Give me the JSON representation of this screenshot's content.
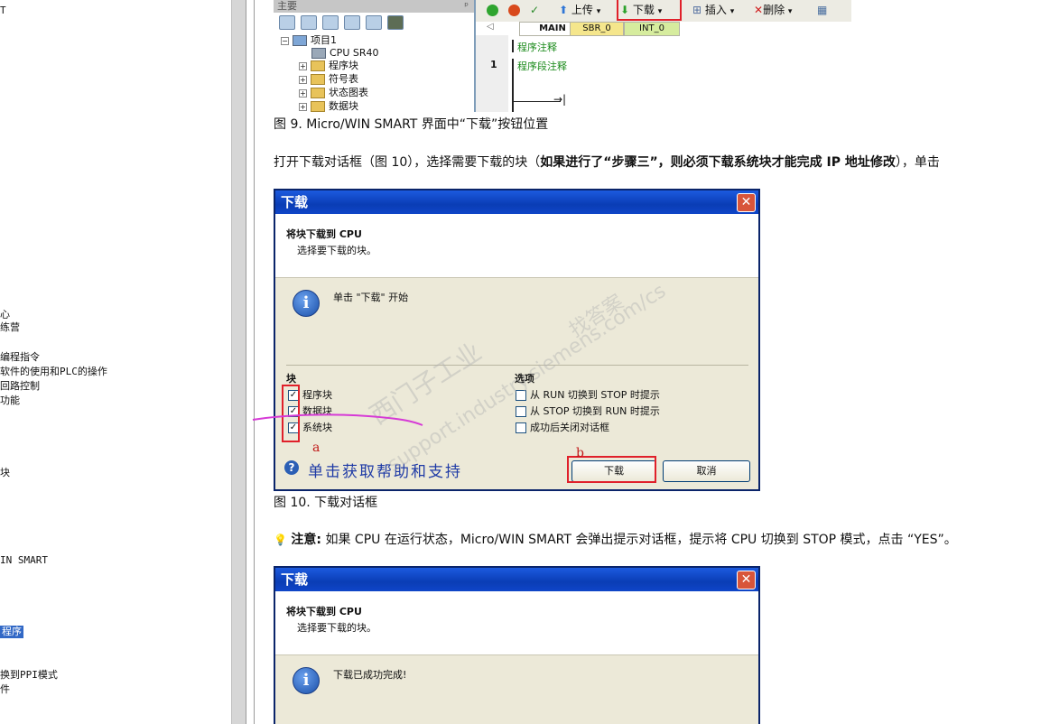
{
  "left_nav": {
    "items": [
      {
        "label": "T",
        "selected": false
      },
      {
        "label": "心",
        "selected": false
      },
      {
        "label": "练营",
        "selected": false
      },
      {
        "label": "编程指令",
        "selected": false
      },
      {
        "label": "软件的使用和PLC的操作",
        "selected": false
      },
      {
        "label": "回路控制",
        "selected": false
      },
      {
        "label": "功能",
        "selected": false
      },
      {
        "label": "块",
        "selected": false
      },
      {
        "label": "IN SMART",
        "selected": false
      },
      {
        "label": "程序",
        "selected": true
      },
      {
        "label": "换到PPI模式",
        "selected": false
      },
      {
        "label": "件",
        "selected": false
      }
    ]
  },
  "fig9": {
    "tree": {
      "header": "主要",
      "pin": "ᵖ",
      "project": "项目1",
      "cpu": "CPU SR40",
      "nodes": [
        "程序块",
        "符号表",
        "状态图表",
        "数据块"
      ]
    },
    "toolbar": {
      "upload": "上传",
      "download": "下载",
      "insert": "插入",
      "delete": "删除"
    },
    "tabs": [
      "MAIN",
      "SBR_0",
      "INT_0"
    ],
    "program_comment": "程序注释",
    "network_number": "1",
    "network_comment": "程序段注释"
  },
  "fig9_caption": "图 9. Micro/WIN SMART 界面中“下载”按钮位置",
  "para1": {
    "prefix": "打开下载对话框（图 10），选择需要下载的块（",
    "bold": "如果进行了“步骤三”，则必须下载系统块才能完成 IP 地址修改",
    "suffix": "），单击"
  },
  "dialog1": {
    "title": "下载",
    "close": "✕",
    "head_title": "将块下载到 CPU",
    "head_sub": "选择要下载的块。",
    "info_icon": "i",
    "message": "单击 \"下载\" 开始",
    "blocks_label": "块",
    "blocks": [
      {
        "label": "程序块",
        "checked": true
      },
      {
        "label": "数据块",
        "checked": true
      },
      {
        "label": "系统块",
        "checked": true
      }
    ],
    "options_label": "选项",
    "options": [
      {
        "label": "从 RUN 切换到 STOP 时提示",
        "checked": false
      },
      {
        "label": "从 STOP 切换到 RUN 时提示",
        "checked": false
      },
      {
        "label": "成功后关闭对话框",
        "checked": false
      }
    ],
    "help_icon": "?",
    "help_text": "单击获取帮助和支持",
    "download_button": "下载",
    "cancel_button": "取消",
    "annotation_a": "a",
    "annotation_b": "b",
    "watermark1": "西门子工业",
    "watermark2": "support.industry.siemens.com/cs",
    "watermark3": "找答案"
  },
  "fig10_caption": "图 10. 下载对话框",
  "note": {
    "icon": "💡",
    "label": "注意:",
    "text": "如果 CPU 在运行状态，Micro/WIN SMART 会弹出提示对话框，提示将 CPU 切换到 STOP 模式，点击 “YES”。"
  },
  "dialog2": {
    "title": "下载",
    "close": "✕",
    "head_title": "将块下载到 CPU",
    "head_sub": "选择要下载的块。",
    "info_icon": "i",
    "message": "下载已成功完成!"
  }
}
